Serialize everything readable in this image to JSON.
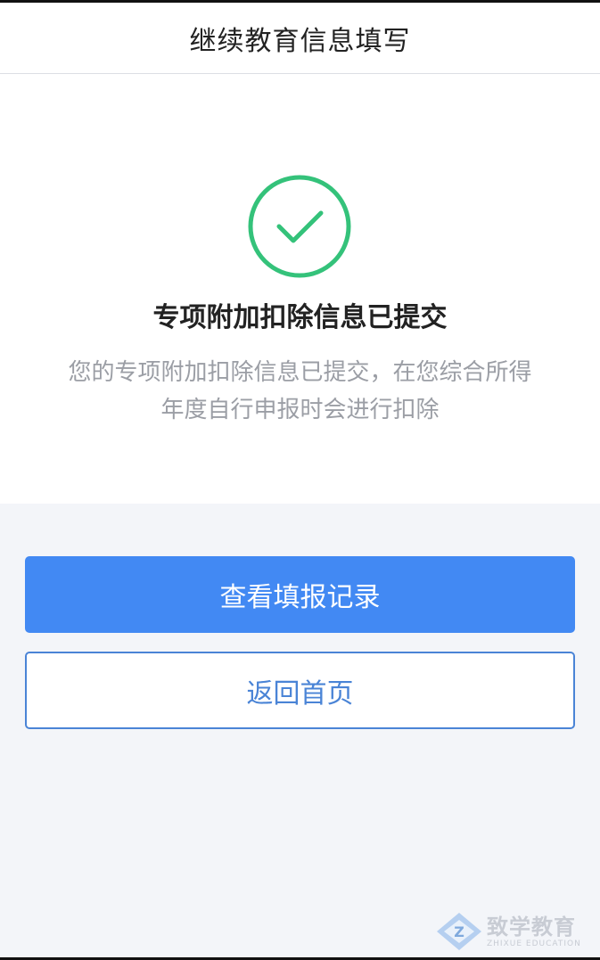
{
  "header": {
    "title": "继续教育信息填写"
  },
  "result": {
    "icon": "check-circle-icon",
    "accent_color": "#34c27a",
    "title": "专项附加扣除信息已提交",
    "description_line1": "您的专项附加扣除信息已提交，在您综合所得",
    "description_line2": "年度自行申报时会进行扣除"
  },
  "actions": {
    "primary_label": "查看填报记录",
    "secondary_label": "返回首页",
    "primary_color": "#4289f3"
  },
  "watermark": {
    "logo": "zhixue-logo-icon",
    "name": "致学教育",
    "name_en": "ZHIXUE EDUCATION"
  }
}
